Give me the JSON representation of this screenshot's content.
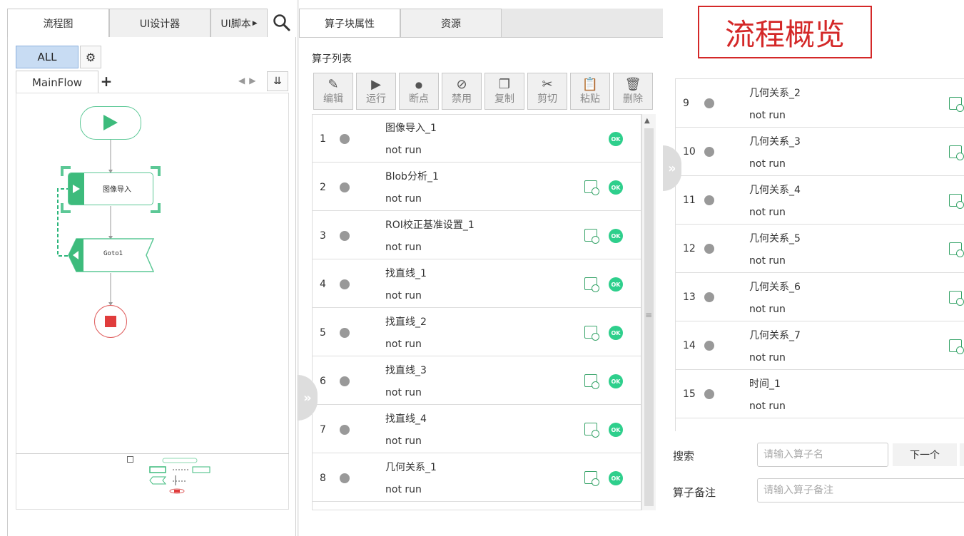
{
  "left_panel": {
    "tabs": [
      {
        "label": "流程图"
      },
      {
        "label": "UI设计器"
      },
      {
        "label": "UI脚本"
      }
    ],
    "filter_button": "ALL",
    "flow_tab": "MainFlow",
    "nodes": {
      "start": "",
      "image_import": "图像导入",
      "goto": "Goto1",
      "stop": ""
    }
  },
  "middle_panel": {
    "tabs": [
      {
        "label": "算子块属性"
      },
      {
        "label": "资源"
      }
    ],
    "section_label": "算子列表",
    "toolbar": [
      {
        "label": "编辑",
        "icon": "edit-icon"
      },
      {
        "label": "运行",
        "icon": "run-icon"
      },
      {
        "label": "断点",
        "icon": "breakpoint-icon"
      },
      {
        "label": "禁用",
        "icon": "disable-icon"
      },
      {
        "label": "复制",
        "icon": "copy-icon"
      },
      {
        "label": "剪切",
        "icon": "scissors-icon"
      },
      {
        "label": "粘贴",
        "icon": "paste-icon"
      },
      {
        "label": "删除",
        "icon": "trash-icon"
      }
    ],
    "ok_label": "OK",
    "operators": [
      {
        "index": "1",
        "name": "图像导入_1",
        "status": "not run"
      },
      {
        "index": "2",
        "name": "Blob分析_1",
        "status": "not run"
      },
      {
        "index": "3",
        "name": "ROI校正基准设置_1",
        "status": "not run"
      },
      {
        "index": "4",
        "name": "找直线_1",
        "status": "not run"
      },
      {
        "index": "5",
        "name": "找直线_2",
        "status": "not run"
      },
      {
        "index": "6",
        "name": "找直线_3",
        "status": "not run"
      },
      {
        "index": "7",
        "name": "找直线_4",
        "status": "not run"
      },
      {
        "index": "8",
        "name": "几何关系_1",
        "status": "not run"
      }
    ]
  },
  "right_panel": {
    "title": "流程概览",
    "operators": [
      {
        "index": "9",
        "name": "几何关系_2",
        "status": "not run"
      },
      {
        "index": "10",
        "name": "几何关系_3",
        "status": "not run"
      },
      {
        "index": "11",
        "name": "几何关系_4",
        "status": "not run"
      },
      {
        "index": "12",
        "name": "几何关系_5",
        "status": "not run"
      },
      {
        "index": "13",
        "name": "几何关系_6",
        "status": "not run"
      },
      {
        "index": "14",
        "name": "几何关系_7",
        "status": "not run"
      },
      {
        "index": "15",
        "name": "时间_1",
        "status": "not run"
      }
    ],
    "search": {
      "label": "搜索",
      "placeholder": "请输入算子名",
      "next_label": "下一个"
    },
    "note": {
      "label": "算子备注",
      "placeholder": "请输入算子备注"
    }
  },
  "colors": {
    "accent_green": "#2ecf8c",
    "stop_red": "#e03c3c",
    "title_red": "#d42828"
  }
}
